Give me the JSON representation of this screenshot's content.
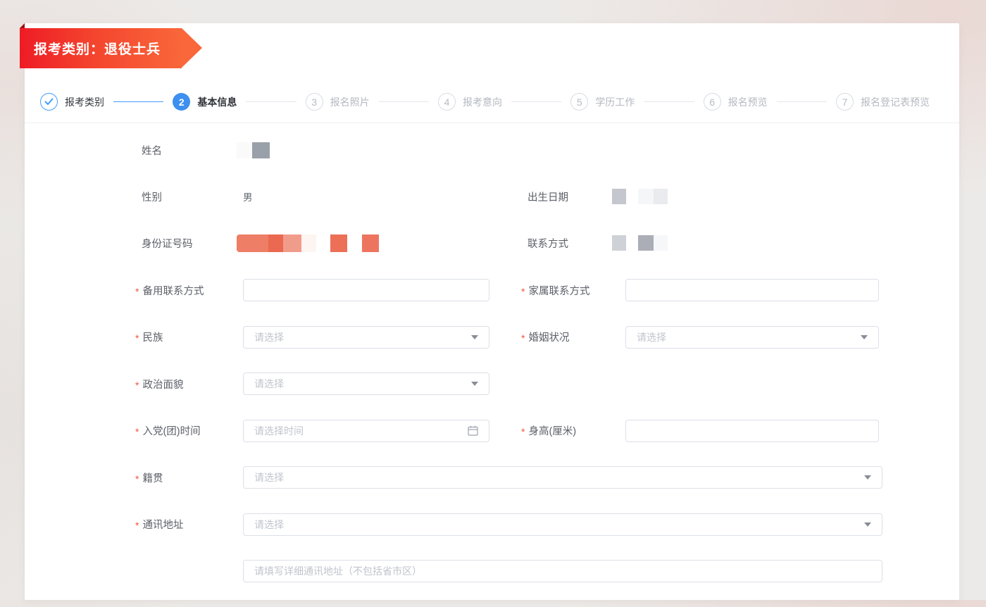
{
  "colors": {
    "brand_red": "#ee1c25",
    "brand_orange": "#f9673a",
    "ribbon_fold_dark_red": "#9e1016",
    "primary_blue": "#409eff",
    "step_inactive_gray": "#b6bac2",
    "label_gray": "#5c6068",
    "placeholder_gray": "#c0c4cc",
    "input_border": "#dcdfe6",
    "required_asterisk_red": "#f0553f",
    "mask_gray_dark": "#9aa0aa",
    "mask_gray_medium": "#c4c7cd",
    "mask_red_salmon": "#ee7e66",
    "mask_red_deep": "#eb6950"
  },
  "ribbon": {
    "text": "报考类别：退役士兵"
  },
  "stepper": {
    "items": [
      {
        "num": "",
        "label": "报考类别",
        "state": "done",
        "icon": "check"
      },
      {
        "num": "2",
        "label": "基本信息",
        "state": "active"
      },
      {
        "num": "3",
        "label": "报名照片",
        "state": "pending"
      },
      {
        "num": "4",
        "label": "报考意向",
        "state": "pending"
      },
      {
        "num": "5",
        "label": "学历工作",
        "state": "pending"
      },
      {
        "num": "6",
        "label": "报名预览",
        "state": "pending"
      },
      {
        "num": "7",
        "label": "报名登记表预览",
        "state": "pending"
      }
    ]
  },
  "form": {
    "required_marker": "*",
    "name": {
      "label": "姓名",
      "masked": true
    },
    "gender": {
      "label": "性别",
      "value": "男"
    },
    "birth_date": {
      "label": "出生日期",
      "masked": true
    },
    "id_number": {
      "label": "身份证号码",
      "masked": true
    },
    "contact": {
      "label": "联系方式",
      "masked": true
    },
    "backup_contact": {
      "label": "备用联系方式",
      "required": true,
      "value": "",
      "placeholder": ""
    },
    "family_contact": {
      "label": "家属联系方式",
      "required": true,
      "value": "",
      "placeholder": ""
    },
    "ethnicity": {
      "label": "民族",
      "required": true,
      "placeholder": "请选择"
    },
    "marital_status": {
      "label": "婚姻状况",
      "required": true,
      "placeholder": "请选择"
    },
    "political_status": {
      "label": "政治面貌",
      "required": true,
      "placeholder": "请选择"
    },
    "party_join_time": {
      "label": "入党(团)时间",
      "required": true,
      "placeholder": "请选择时间"
    },
    "height_cm": {
      "label": "身高(厘米)",
      "required": true,
      "value": "",
      "placeholder": ""
    },
    "native_place": {
      "label": "籍贯",
      "required": true,
      "placeholder": "请选择"
    },
    "mailing_address": {
      "label": "通讯地址",
      "required": true,
      "placeholder": "请选择"
    },
    "mailing_address_detail": {
      "placeholder": "请填写详细通讯地址（不包括省市区）"
    }
  }
}
